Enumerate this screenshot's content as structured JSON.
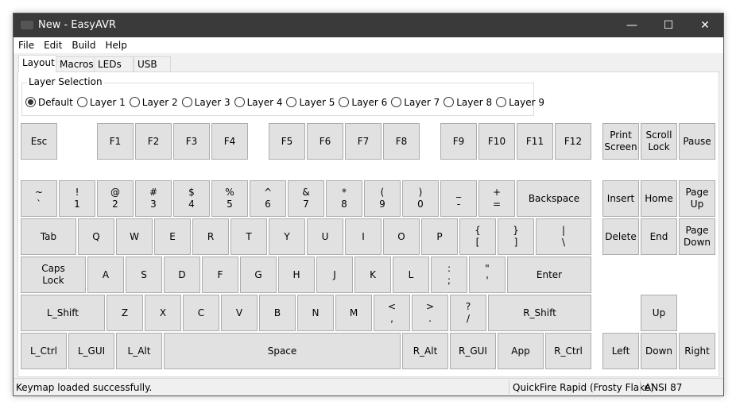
{
  "window": {
    "title": "New - EasyAVR",
    "minimize": "—",
    "maximize": "☐",
    "close": "✕"
  },
  "menu": [
    "File",
    "Edit",
    "Build",
    "Help"
  ],
  "tabs": [
    "Layout",
    "Macros",
    "LEDs",
    "USB"
  ],
  "layer_group": {
    "title": "Layer Selection",
    "options": [
      "Default",
      "Layer 1",
      "Layer 2",
      "Layer 3",
      "Layer 4",
      "Layer 5",
      "Layer 6",
      "Layer 7",
      "Layer 8",
      "Layer 9"
    ],
    "selected": "Default"
  },
  "keys": [
    "Esc",
    "F1",
    "F2",
    "F3",
    "F4",
    "F5",
    "F6",
    "F7",
    "F8",
    "F9",
    "F10",
    "F11",
    "F12",
    "Print\nScreen",
    "Scroll\nLock",
    "Pause",
    "~\n`",
    "!\n1",
    "@\n2",
    "#\n3",
    "$\n4",
    "%\n5",
    "^\n6",
    "&\n7",
    "*\n8",
    "(\n9",
    ")\n0",
    "_\n-",
    "+\n=",
    "Backspace",
    "Insert",
    "Home",
    "Page\nUp",
    "Tab",
    "Q",
    "W",
    "E",
    "R",
    "T",
    "Y",
    "U",
    "I",
    "O",
    "P",
    "{\n[",
    "}\n]",
    "|\n\\",
    "Delete",
    "End",
    "Page\nDown",
    "Caps\nLock",
    "A",
    "S",
    "D",
    "F",
    "G",
    "H",
    "J",
    "K",
    "L",
    ":\n;",
    "\"\n'",
    "Enter",
    "L_Shift",
    "Z",
    "X",
    "C",
    "V",
    "B",
    "N",
    "M",
    "<\n,",
    ">\n.",
    "?\n/",
    "R_Shift",
    "Up",
    "L_Ctrl",
    "L_GUI",
    "L_Alt",
    "Space",
    "R_Alt",
    "R_GUI",
    "App",
    "R_Ctrl",
    "Left",
    "Down",
    "Right"
  ],
  "status": {
    "message": "Keymap loaded successfully.",
    "keyboard": "QuickFire Rapid (Frosty Flake)",
    "layout": "ANSI 87"
  }
}
